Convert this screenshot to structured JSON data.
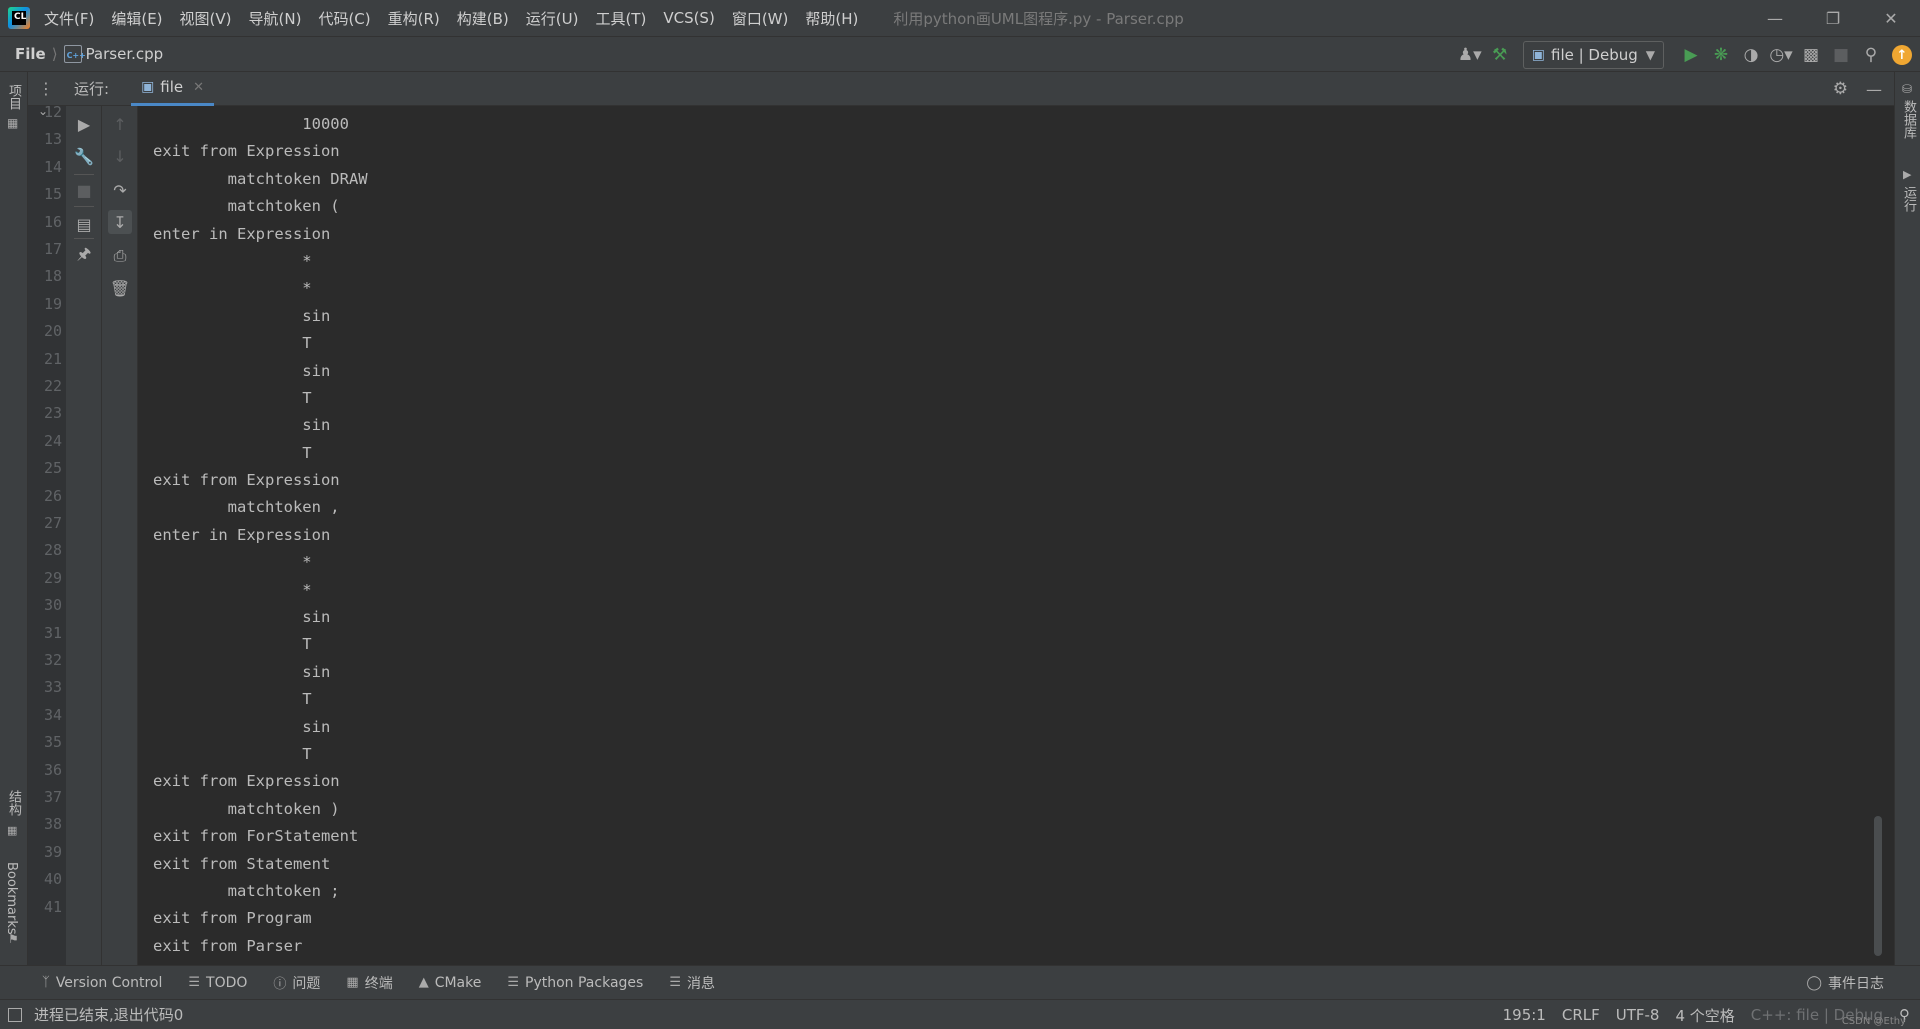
{
  "menubar": {
    "items": [
      "文件(F)",
      "编辑(E)",
      "视图(V)",
      "导航(N)",
      "代码(C)",
      "重构(R)",
      "构建(B)",
      "运行(U)",
      "工具(T)",
      "VCS(S)",
      "窗口(W)",
      "帮助(H)"
    ],
    "title": "利用python画UML图程序.py - Parser.cpp",
    "app_logo": "CL"
  },
  "navbar": {
    "project": "File",
    "file": "Parser.cpp",
    "run_config": "file | Debug"
  },
  "left_strip": {
    "project_tab": "项目",
    "structure_tab": "结构",
    "bookmarks_tab": "Bookmarks"
  },
  "right_strip": {
    "database_tab": "数据库",
    "run_tab": "运行"
  },
  "run_panel": {
    "label": "运行:",
    "tab_name": "file"
  },
  "gutter": {
    "line_numbers": [
      "12",
      "13",
      "14",
      "15",
      "16",
      "17",
      "18",
      "19",
      "20",
      "21",
      "22",
      "23",
      "24",
      "25",
      "26",
      "27",
      "28",
      "29",
      "30",
      "31",
      "32",
      "33",
      "34",
      "35",
      "36",
      "37",
      "38",
      "39",
      "40",
      "41"
    ]
  },
  "console": {
    "lines": [
      "                10000",
      "exit from Expression",
      "        matchtoken DRAW",
      "        matchtoken (",
      "enter in Expression",
      "                *",
      "                *",
      "                sin",
      "                T",
      "                sin",
      "                T",
      "                sin",
      "                T",
      "exit from Expression",
      "        matchtoken ,",
      "enter in Expression",
      "                *",
      "                *",
      "                sin",
      "                T",
      "                sin",
      "                T",
      "                sin",
      "                T",
      "exit from Expression",
      "        matchtoken )",
      "exit from ForStatement",
      "exit from Statement",
      "        matchtoken ;",
      "exit from Program",
      "exit from Parser"
    ]
  },
  "tool_tabs": {
    "version_control": "Version Control",
    "todo": "TODO",
    "problems": "问题",
    "terminal": "终端",
    "cmake": "CMake",
    "python_packages": "Python Packages",
    "messages": "消息",
    "event_log": "事件日志"
  },
  "status_bar": {
    "message": "进程已结束,退出代码0",
    "position": "195:1",
    "line_sep": "CRLF",
    "encoding": "UTF-8",
    "indent": "4 个空格",
    "context": "C++: file | Debug",
    "watermark": "CSDN @Ethy"
  }
}
